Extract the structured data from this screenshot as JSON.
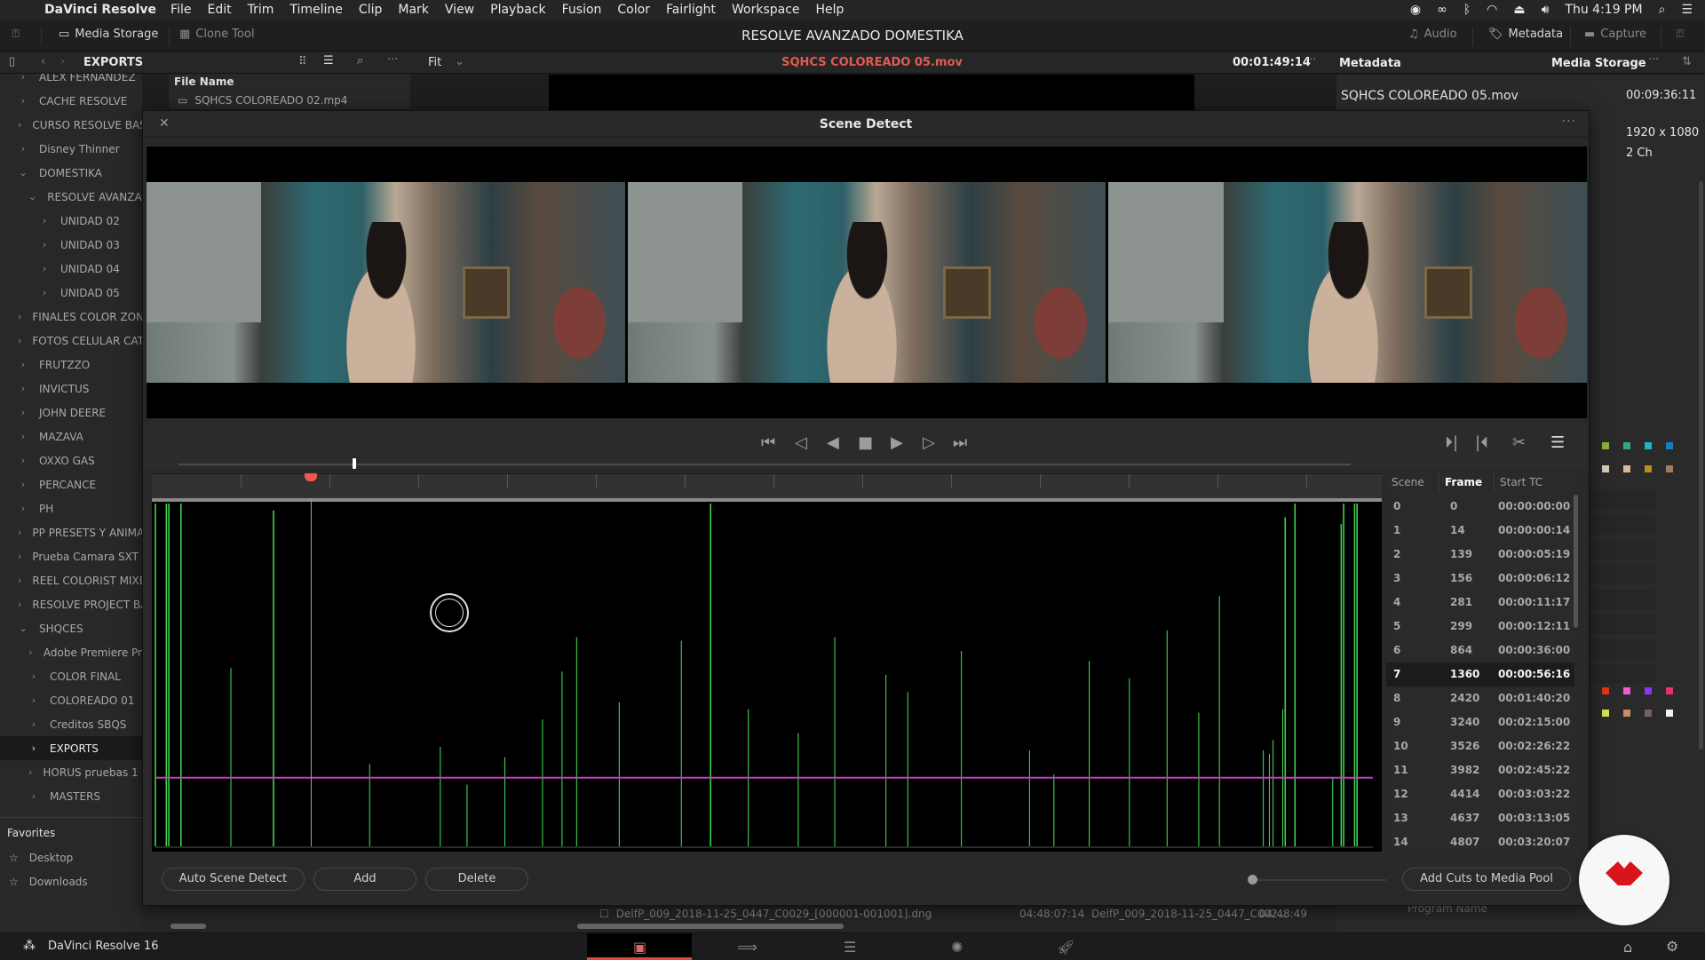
{
  "menubar": {
    "app_name": "DaVinci Resolve",
    "items": [
      "File",
      "Edit",
      "Trim",
      "Timeline",
      "Clip",
      "Mark",
      "View",
      "Playback",
      "Fusion",
      "Color",
      "Fairlight",
      "Workspace",
      "Help"
    ],
    "clock": "Thu 4:19 PM"
  },
  "toolbar": {
    "media_storage": "Media Storage",
    "clone_tool": "Clone Tool",
    "project_title": "RESOLVE AVANZADO DOMESTIKA",
    "audio": "Audio",
    "metadata": "Metadata",
    "capture": "Capture"
  },
  "panel_header": {
    "folder": "EXPORTS",
    "zoom": "Fit",
    "clip_name": "SQHCS COLOREADO 05.mov",
    "timecode": "00:01:49:14",
    "metadata_title": "Metadata",
    "media_storage": "Media Storage"
  },
  "sidebar": {
    "items": [
      {
        "label": "ALEX FERNANDEZ",
        "depth": 0,
        "state": "collapsed"
      },
      {
        "label": "CACHE RESOLVE",
        "depth": 0,
        "state": "collapsed"
      },
      {
        "label": "CURSO RESOLVE BAS",
        "depth": 0,
        "state": "collapsed"
      },
      {
        "label": "Disney Thinner",
        "depth": 0,
        "state": "collapsed"
      },
      {
        "label": "DOMESTIKA",
        "depth": 0,
        "state": "expanded"
      },
      {
        "label": "RESOLVE AVANZAD",
        "depth": 1,
        "state": "expanded"
      },
      {
        "label": "UNIDAD 02",
        "depth": 2,
        "state": "collapsed"
      },
      {
        "label": "UNIDAD 03",
        "depth": 2,
        "state": "collapsed"
      },
      {
        "label": "UNIDAD 04",
        "depth": 2,
        "state": "collapsed"
      },
      {
        "label": "UNIDAD 05",
        "depth": 2,
        "state": "collapsed"
      },
      {
        "label": "FINALES COLOR ZON",
        "depth": 0,
        "state": "collapsed"
      },
      {
        "label": "FOTOS CELULAR CAT",
        "depth": 0,
        "state": "collapsed"
      },
      {
        "label": "FRUTZZO",
        "depth": 0,
        "state": "collapsed"
      },
      {
        "label": "INVICTUS",
        "depth": 0,
        "state": "collapsed"
      },
      {
        "label": "JOHN DEERE",
        "depth": 0,
        "state": "collapsed"
      },
      {
        "label": "MAZAVA",
        "depth": 0,
        "state": "collapsed"
      },
      {
        "label": "OXXO GAS",
        "depth": 0,
        "state": "collapsed"
      },
      {
        "label": "PERCANCE",
        "depth": 0,
        "state": "collapsed"
      },
      {
        "label": "PH",
        "depth": 0,
        "state": "collapsed"
      },
      {
        "label": "PP PRESETS Y ANIMA",
        "depth": 0,
        "state": "collapsed"
      },
      {
        "label": "Prueba Camara SXT -",
        "depth": 0,
        "state": "collapsed"
      },
      {
        "label": "REEL COLORIST MIXE",
        "depth": 0,
        "state": "collapsed"
      },
      {
        "label": "RESOLVE PROJECT BA",
        "depth": 0,
        "state": "collapsed"
      },
      {
        "label": "SHQCES",
        "depth": 0,
        "state": "expanded"
      },
      {
        "label": "Adobe Premiere Pr",
        "depth": 1,
        "state": "collapsed"
      },
      {
        "label": "COLOR FINAL",
        "depth": 1,
        "state": "collapsed"
      },
      {
        "label": "COLOREADO 01",
        "depth": 1,
        "state": "collapsed"
      },
      {
        "label": "Creditos SBQS",
        "depth": 1,
        "state": "collapsed"
      },
      {
        "label": "EXPORTS",
        "depth": 1,
        "state": "collapsed",
        "selected": true
      },
      {
        "label": "HORUS pruebas 1 -",
        "depth": 1,
        "state": "collapsed"
      },
      {
        "label": "MASTERS",
        "depth": 1,
        "state": "collapsed"
      }
    ],
    "favorites_title": "Favorites",
    "favorites": [
      "Desktop",
      "Downloads"
    ]
  },
  "file_list": {
    "column": "File Name",
    "rows": [
      "SQHCS COLOREADO 02.mp4"
    ],
    "bottom_row": {
      "name": "DelfP_009_2018-11-25_0447_C0029_[000001-001001].dng",
      "tc1": "04:48:07:14",
      "name2": "DelfP_009_2018-11-25_0447_C002...",
      "tc2": "04:48:49"
    }
  },
  "metadata": {
    "clip_name": "SQHCS COLOREADO 05.mov",
    "duration": "00:09:36:11",
    "resolution": "1920 x 1080",
    "audio": "2 Ch",
    "partial_label": "Program Name"
  },
  "scene_detect": {
    "title": "Scene Detect",
    "table_headers": [
      "Scene",
      "Frame",
      "Start TC"
    ],
    "scenes": [
      {
        "scene": "0",
        "frame": "0",
        "tc": "00:00:00:00"
      },
      {
        "scene": "1",
        "frame": "14",
        "tc": "00:00:00:14"
      },
      {
        "scene": "2",
        "frame": "139",
        "tc": "00:00:05:19"
      },
      {
        "scene": "3",
        "frame": "156",
        "tc": "00:00:06:12"
      },
      {
        "scene": "4",
        "frame": "281",
        "tc": "00:00:11:17"
      },
      {
        "scene": "5",
        "frame": "299",
        "tc": "00:00:12:11"
      },
      {
        "scene": "6",
        "frame": "864",
        "tc": "00:00:36:00"
      },
      {
        "scene": "7",
        "frame": "1360",
        "tc": "00:00:56:16",
        "selected": true
      },
      {
        "scene": "8",
        "frame": "2420",
        "tc": "00:01:40:20"
      },
      {
        "scene": "9",
        "frame": "3240",
        "tc": "00:02:15:00"
      },
      {
        "scene": "10",
        "frame": "3526",
        "tc": "00:02:26:22"
      },
      {
        "scene": "11",
        "frame": "3982",
        "tc": "00:02:45:22"
      },
      {
        "scene": "12",
        "frame": "4414",
        "tc": "00:03:03:22"
      },
      {
        "scene": "13",
        "frame": "4637",
        "tc": "00:03:13:05"
      },
      {
        "scene": "14",
        "frame": "4807",
        "tc": "00:03:20:07"
      }
    ],
    "buttons": {
      "auto_detect": "Auto Scene Detect",
      "add": "Add",
      "delete": "Delete",
      "add_cuts": "Add Cuts to Media Pool"
    },
    "threshold": 0.2,
    "playhead": 0.128,
    "zoom_level": 0.0,
    "cut_spikes": [
      {
        "x": 0.0,
        "h": 1.0
      },
      {
        "x": 0.009,
        "h": 1.0
      },
      {
        "x": 0.011,
        "h": 1.0
      },
      {
        "x": 0.021,
        "h": 1.0
      },
      {
        "x": 0.062,
        "h": 0.52
      },
      {
        "x": 0.097,
        "h": 0.98
      },
      {
        "x": 0.176,
        "h": 0.24
      },
      {
        "x": 0.234,
        "h": 0.29
      },
      {
        "x": 0.256,
        "h": 0.18
      },
      {
        "x": 0.287,
        "h": 0.26
      },
      {
        "x": 0.318,
        "h": 0.37
      },
      {
        "x": 0.334,
        "h": 0.51
      },
      {
        "x": 0.346,
        "h": 0.61
      },
      {
        "x": 0.381,
        "h": 0.42
      },
      {
        "x": 0.432,
        "h": 0.6
      },
      {
        "x": 0.456,
        "h": 1.0
      },
      {
        "x": 0.487,
        "h": 0.4
      },
      {
        "x": 0.528,
        "h": 0.33
      },
      {
        "x": 0.558,
        "h": 0.61
      },
      {
        "x": 0.6,
        "h": 0.5
      },
      {
        "x": 0.618,
        "h": 0.45
      },
      {
        "x": 0.662,
        "h": 0.57
      },
      {
        "x": 0.718,
        "h": 0.28
      },
      {
        "x": 0.738,
        "h": 0.21
      },
      {
        "x": 0.767,
        "h": 0.54
      },
      {
        "x": 0.8,
        "h": 0.49
      },
      {
        "x": 0.831,
        "h": 0.63
      },
      {
        "x": 0.857,
        "h": 0.39
      },
      {
        "x": 0.874,
        "h": 0.73
      },
      {
        "x": 0.91,
        "h": 0.28
      },
      {
        "x": 0.915,
        "h": 0.27
      },
      {
        "x": 0.918,
        "h": 0.31
      },
      {
        "x": 0.926,
        "h": 0.4
      },
      {
        "x": 0.928,
        "h": 0.96
      },
      {
        "x": 0.936,
        "h": 1.0
      },
      {
        "x": 0.967,
        "h": 0.2
      },
      {
        "x": 0.974,
        "h": 0.94
      },
      {
        "x": 0.976,
        "h": 1.0
      },
      {
        "x": 0.985,
        "h": 1.0
      },
      {
        "x": 0.987,
        "h": 1.0
      }
    ]
  },
  "pages": [
    "Media",
    "Cut",
    "Edit",
    "Fusion",
    "Deliver"
  ],
  "status": {
    "app_version": "DaVinci Resolve 16"
  },
  "colors": {
    "accent_red": "#f1574a",
    "spike_green": "#3fd34f",
    "threshold_magenta": "#c13fbd"
  }
}
